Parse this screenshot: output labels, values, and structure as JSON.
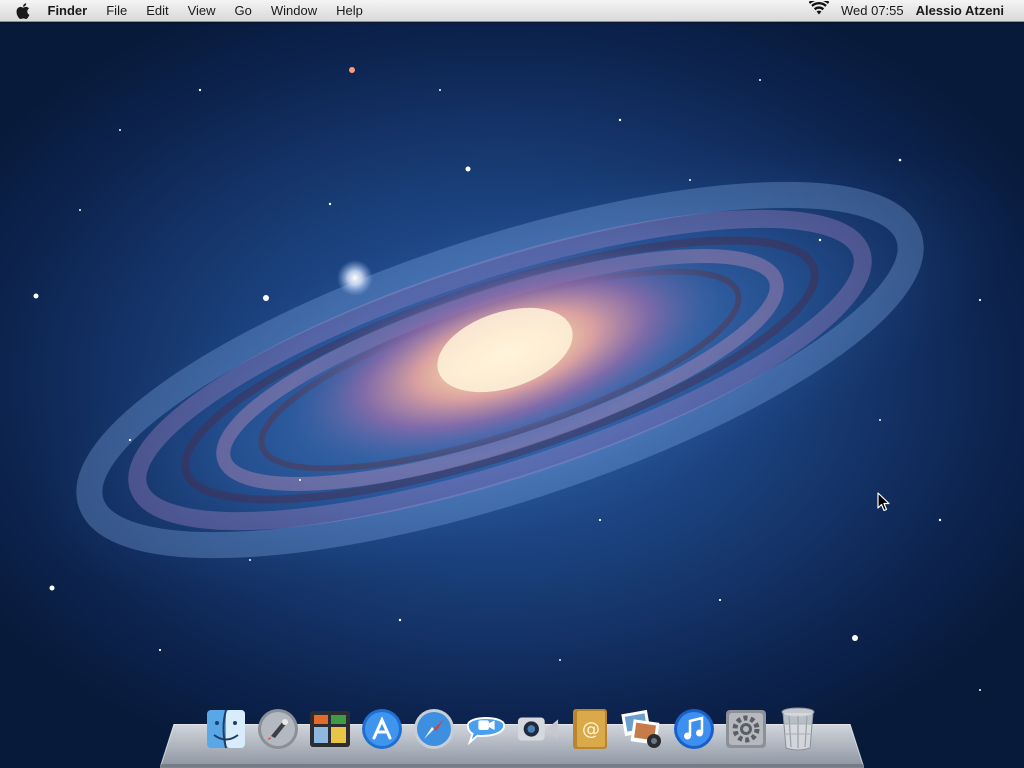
{
  "menubar": {
    "apple_icon": "apple-icon",
    "app_name": "Finder",
    "menus": [
      "File",
      "Edit",
      "View",
      "Go",
      "Window",
      "Help"
    ],
    "wifi_icon": "wifi-icon",
    "clock": "Wed 07:55",
    "user": "Alessio Atzeni"
  },
  "dock": {
    "items": [
      {
        "icon": "finder-icon"
      },
      {
        "icon": "launchpad-icon"
      },
      {
        "icon": "mission-control-icon"
      },
      {
        "icon": "app-store-icon"
      },
      {
        "icon": "safari-icon"
      },
      {
        "icon": "ichat-icon"
      },
      {
        "icon": "facetime-icon"
      },
      {
        "icon": "address-book-icon"
      },
      {
        "icon": "photo-booth-icon"
      },
      {
        "icon": "itunes-icon"
      },
      {
        "icon": "system-preferences-icon"
      },
      {
        "icon": "trash-icon"
      }
    ]
  },
  "colors": {
    "menubar_top": "#f4f4f4",
    "menubar_bottom": "#d9d9d9",
    "wallpaper_deep": "#081a3a",
    "wallpaper_mid": "#2a5fa8"
  }
}
